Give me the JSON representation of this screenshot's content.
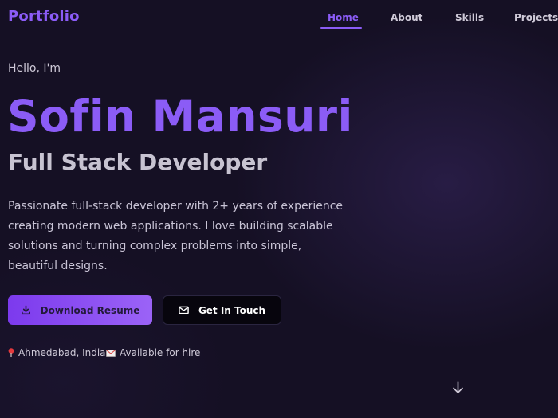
{
  "navbar": {
    "logo": "Portfolio",
    "items": [
      {
        "label": "Home",
        "active": true
      },
      {
        "label": "About",
        "active": false
      },
      {
        "label": "Skills",
        "active": false
      },
      {
        "label": "Projects",
        "active": false
      }
    ]
  },
  "hero": {
    "greeting": "Hello, I'm",
    "name": "Sofin Mansuri",
    "role": "Full Stack Developer",
    "description": "Passionate full-stack developer with 2+ years of experience creating modern web applications. I love building scalable solutions and turning complex problems into simple, beautiful designs.",
    "primary_button": {
      "label": "Download Resume",
      "icon": "download-icon"
    },
    "secondary_button": {
      "label": "Get In Touch",
      "icon": "mail-icon"
    },
    "location": {
      "text": "Ahmedabad, India",
      "icon": "pin-icon"
    },
    "availability": {
      "text": "Available for hire",
      "icon": "envelope-icon"
    },
    "scroll_icon": "arrow-down-icon"
  },
  "colors": {
    "background": "#151024",
    "accent": "#8b5cf6",
    "text": "#c9c4d6"
  }
}
